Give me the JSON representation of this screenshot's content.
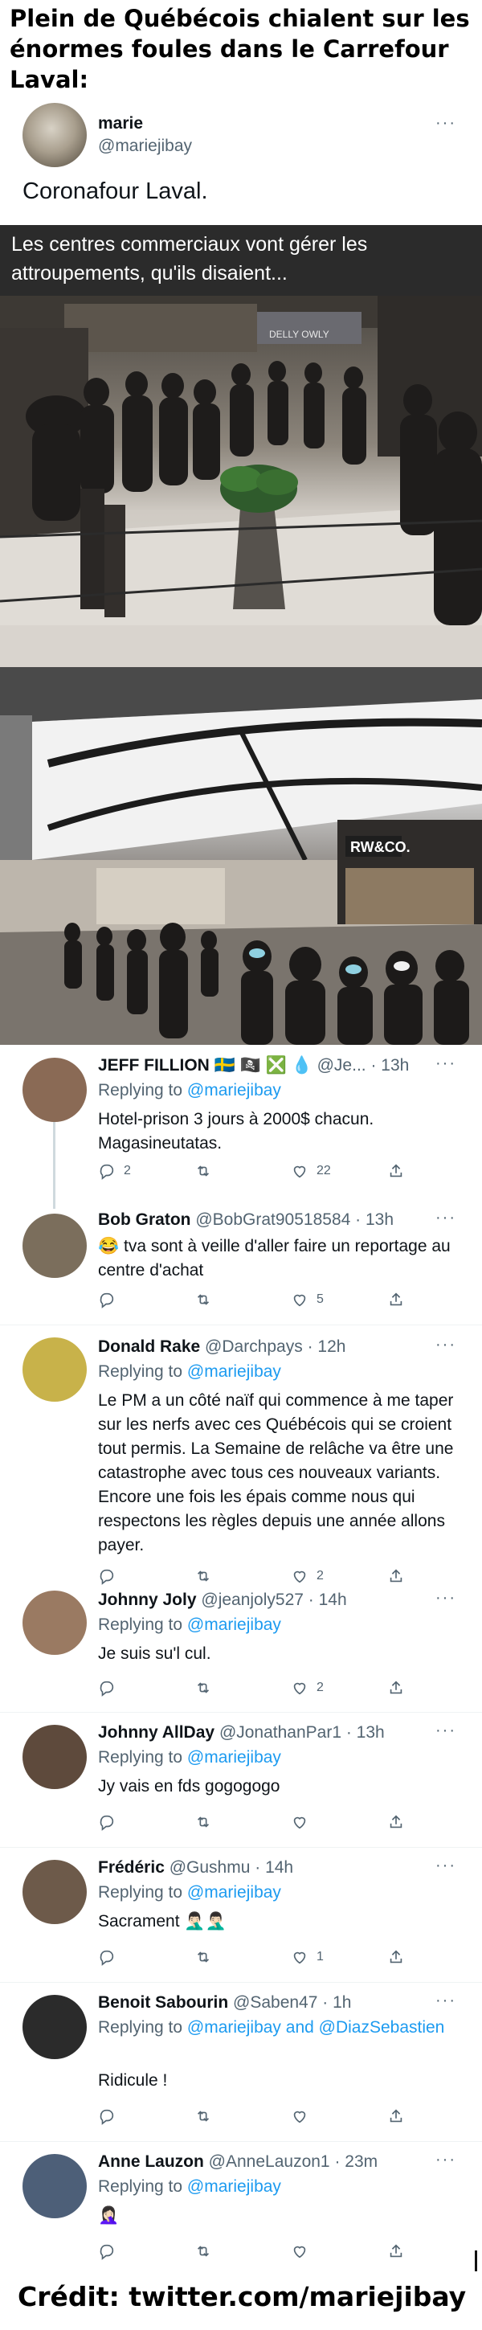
{
  "headline": "Plein de Québécois chialent sur les énormes foules dans le Carrefour Laval:",
  "original_tweet": {
    "name": "marie",
    "handle": "@mariejibay",
    "more": "···",
    "text": "Coronafour Laval.",
    "media_caption": "Les centres commerciaux vont gérer les attroupements, qu'ils disaient..."
  },
  "photos": {
    "store_sign_1": "DELLY OWLY",
    "store_sign_2": "RW&CO."
  },
  "replies": [
    {
      "name": "JEFF FILLION 🇸🇪 🏴‍☠️ ❎ 💧",
      "handle": "@Je... · 13h",
      "reply_label": "Replying to",
      "reply_to": "@mariejibay",
      "text": "Hotel-prison 3 jours à 2000$ chacun. Magasineutatas.",
      "counts": {
        "reply": "2",
        "retweet": "",
        "like": "22"
      },
      "avatar_color": "#8a6a55"
    },
    {
      "name": "Bob Graton",
      "handle": "@BobGrat90518584 · 13h",
      "reply_label": "",
      "reply_to": "",
      "text": "😂 tva sont à veille d'aller faire un reportage au centre d'achat",
      "counts": {
        "reply": "",
        "retweet": "",
        "like": "5"
      },
      "avatar_color": "#7b6e5c"
    },
    {
      "name": "Donald Rake",
      "handle": "@Darchpays · 12h",
      "reply_label": "Replying to",
      "reply_to": "@mariejibay",
      "text": "Le PM a un côté naïf qui commence à me taper sur les nerfs avec ces Québécois qui se croient tout permis. La Semaine de relâche va être une catastrophe avec tous ces nouveaux variants. Encore une fois les épais comme nous qui respectons les règles depuis une année allons payer.",
      "counts": {
        "reply": "",
        "retweet": "",
        "like": "2"
      },
      "avatar_color": "#c8b24a"
    },
    {
      "name": "Johnny Joly",
      "handle": "@jeanjoly527 · 14h",
      "reply_label": "Replying to",
      "reply_to": "@mariejibay",
      "text": "Je suis su'l cul.",
      "counts": {
        "reply": "",
        "retweet": "",
        "like": "2"
      },
      "avatar_color": "#9a7a62"
    },
    {
      "name": "Johnny AllDay",
      "handle": "@JonathanPar1 · 13h",
      "reply_label": "Replying to",
      "reply_to": "@mariejibay",
      "text": "Jy vais en fds gogogogo",
      "counts": {
        "reply": "",
        "retweet": "",
        "like": ""
      },
      "avatar_color": "#5e4a3c"
    },
    {
      "name": "Frédéric",
      "handle": "@Gushmu · 14h",
      "reply_label": "Replying to",
      "reply_to": "@mariejibay",
      "text": "Sacrament 🤦🏻‍♂️🤦🏻‍♂️",
      "counts": {
        "reply": "",
        "retweet": "",
        "like": "1"
      },
      "avatar_color": "#6d5a4a"
    },
    {
      "name": "Benoit Sabourin",
      "handle": "@Saben47 · 1h",
      "reply_label": "Replying to",
      "reply_to": "@mariejibay and @DiazSebastien",
      "text": "Ridicule !",
      "counts": {
        "reply": "",
        "retweet": "",
        "like": ""
      },
      "avatar_color": "#2b2b2b"
    },
    {
      "name": "Anne Lauzon",
      "handle": "@AnneLauzon1 · 23m",
      "reply_label": "Replying to",
      "reply_to": "@mariejibay",
      "text": "🤦🏻‍♀️",
      "counts": {
        "reply": "",
        "retweet": "",
        "like": ""
      },
      "avatar_color": "#4d5f78"
    }
  ],
  "credit": "Crédit: twitter.com/mariejibay",
  "colors": {
    "link": "#1d9bf0",
    "muted": "#536471",
    "caption_band": "#2b2b2b"
  },
  "icons": [
    "reply-icon",
    "retweet-icon",
    "like-icon",
    "share-icon",
    "more-icon"
  ]
}
